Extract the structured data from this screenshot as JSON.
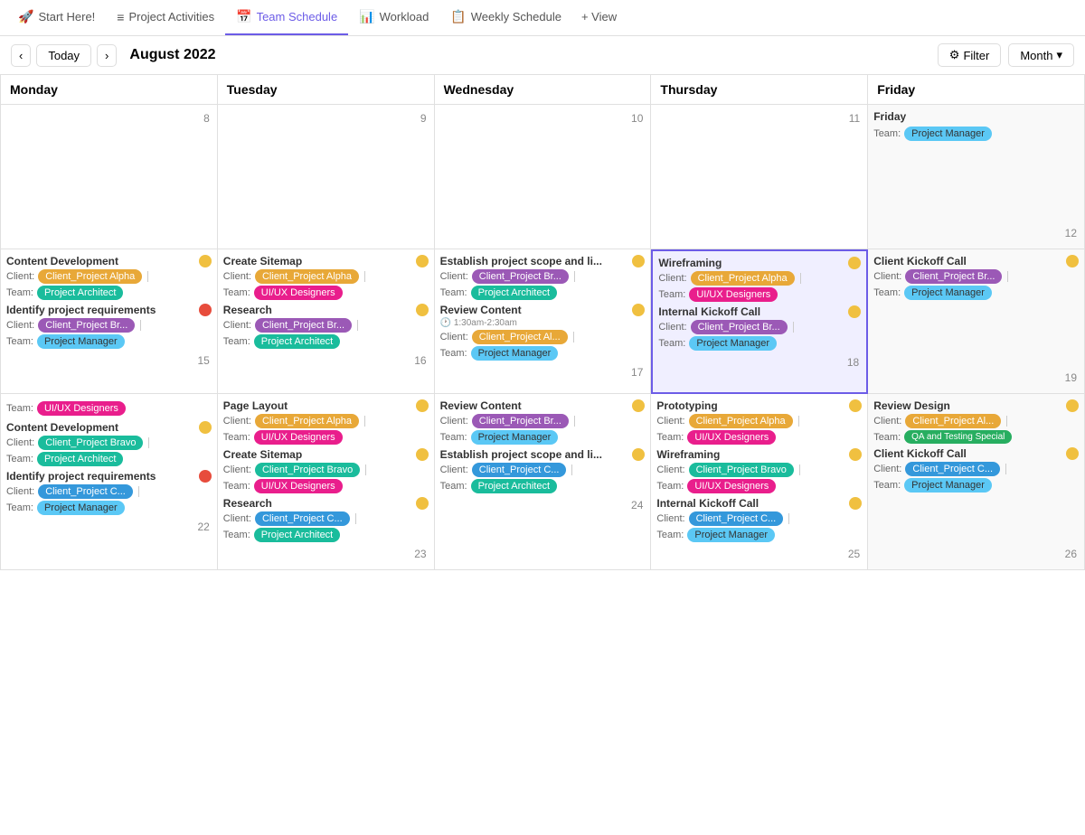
{
  "nav": {
    "tabs": [
      {
        "id": "start",
        "label": "Start Here!",
        "icon": "🚀",
        "active": false
      },
      {
        "id": "project-activities",
        "label": "Project Activities",
        "icon": "≡",
        "active": false
      },
      {
        "id": "team-schedule",
        "label": "Team Schedule",
        "icon": "📅",
        "active": true
      },
      {
        "id": "workload",
        "label": "Workload",
        "icon": "📊",
        "active": false
      },
      {
        "id": "weekly-schedule",
        "label": "Weekly Schedule",
        "icon": "📋",
        "active": false
      },
      {
        "id": "view",
        "label": "+ View",
        "icon": "",
        "active": false
      }
    ]
  },
  "toolbar": {
    "today_label": "Today",
    "month_display": "August 2022",
    "filter_label": "Filter",
    "month_label": "Month"
  },
  "calendar": {
    "headers": [
      "Monday",
      "Tuesday",
      "Wednesday",
      "Thursday",
      "Friday"
    ],
    "weeks": [
      {
        "days": [
          {
            "num": "8",
            "events": [],
            "highlighted": false
          },
          {
            "num": "9",
            "events": [],
            "highlighted": false
          },
          {
            "num": "10",
            "events": [],
            "highlighted": false
          },
          {
            "num": "11",
            "events": [],
            "highlighted": false
          },
          {
            "num": "12",
            "events": [],
            "highlighted": false,
            "partial": true
          }
        ]
      },
      {
        "days": [
          {
            "num": "15",
            "highlighted": false,
            "events": [
              {
                "title": "Content Development",
                "dot": "yellow",
                "client_label": "Client:",
                "client_tag": "Client_Project Alpha",
                "client_tag_color": "orange",
                "team_label": "Team:",
                "team_tag": "Project Architect",
                "team_tag_color": "teal"
              },
              {
                "title": "Identify project requirements",
                "dot": "red",
                "client_label": "Client:",
                "client_tag": "Client_Project Br...",
                "client_tag_color": "purple",
                "team_label": "Team:",
                "team_tag": "Project Manager",
                "team_tag_color": "light-blue"
              }
            ]
          },
          {
            "num": "16",
            "highlighted": false,
            "events": [
              {
                "title": "Create Sitemap",
                "dot": "yellow",
                "client_label": "Client:",
                "client_tag": "Client_Project Alpha",
                "client_tag_color": "orange",
                "team_label": "Team:",
                "team_tag": "UI/UX Designers",
                "team_tag_color": "pink"
              },
              {
                "title": "Research",
                "dot": "yellow",
                "client_label": "Client:",
                "client_tag": "Client_Project Br...",
                "client_tag_color": "purple",
                "team_label": "Team:",
                "team_tag": "Project Architect",
                "team_tag_color": "teal"
              }
            ]
          },
          {
            "num": "17",
            "highlighted": false,
            "events": [
              {
                "title": "Establish project scope and li...",
                "dot": "yellow",
                "client_label": "Client:",
                "client_tag": "Client_Project Br...",
                "client_tag_color": "purple",
                "team_label": "Team:",
                "team_tag": "Project Architect",
                "team_tag_color": "teal"
              },
              {
                "title": "Review Content",
                "dot": "yellow",
                "time": "🕐 1:30am-2:30am",
                "client_label": "Client:",
                "client_tag": "Client_Project Al...",
                "client_tag_color": "orange",
                "team_label": "Team:",
                "team_tag": "Project Manager",
                "team_tag_color": "light-blue"
              }
            ]
          },
          {
            "num": "18",
            "highlighted": true,
            "events": [
              {
                "title": "Wireframing",
                "dot": "yellow",
                "client_label": "Client:",
                "client_tag": "Client_Project Alpha",
                "client_tag_color": "orange",
                "team_label": "Team:",
                "team_tag": "UI/UX Designers",
                "team_tag_color": "pink"
              },
              {
                "title": "Internal Kickoff Call",
                "dot": "yellow",
                "client_label": "Client:",
                "client_tag": "Client_Project Br...",
                "client_tag_color": "purple",
                "team_label": "Team:",
                "team_tag": "Project Manager",
                "team_tag_color": "light-blue"
              }
            ]
          },
          {
            "num": "19",
            "highlighted": false,
            "partial": true,
            "pre_events": [
              {
                "team_label": "Team:",
                "team_tag": "Project Manager",
                "team_tag_color": "light-blue"
              }
            ],
            "events": [
              {
                "title": "Client Kickoff Call",
                "dot": "yellow",
                "client_label": "Client:",
                "client_tag": "Client_Project Br...",
                "client_tag_color": "purple",
                "team_label": "Team:",
                "team_tag": "Project Manager",
                "team_tag_color": "light-blue"
              }
            ]
          }
        ]
      },
      {
        "days": [
          {
            "num": "22",
            "highlighted": false,
            "pre_events": [
              {
                "team_label": "Team:",
                "team_tag": "UI/UX Designers",
                "team_tag_color": "pink"
              }
            ],
            "events": [
              {
                "title": "Content Development",
                "dot": "yellow",
                "client_label": "Client:",
                "client_tag": "Client_Project Bravo",
                "client_tag_color": "teal",
                "team_label": "Team:",
                "team_tag": "Project Architect",
                "team_tag_color": "teal"
              },
              {
                "title": "Identify project requirements",
                "dot": "red",
                "client_label": "Client:",
                "client_tag": "Client_Project C...",
                "client_tag_color": "blue",
                "team_label": "Team:",
                "team_tag": "Project Manager",
                "team_tag_color": "light-blue"
              }
            ]
          },
          {
            "num": "23",
            "highlighted": false,
            "pre_events": [
              {
                "title": "Page Layout",
                "dot": "yellow",
                "client_label": "Client:",
                "client_tag": "Client_Project Alpha",
                "client_tag_color": "orange",
                "team_label": "Team:",
                "team_tag": "UI/UX Designers",
                "team_tag_color": "pink"
              }
            ],
            "events": [
              {
                "title": "Create Sitemap",
                "dot": "yellow",
                "client_label": "Client:",
                "client_tag": "Client_Project Bravo",
                "client_tag_color": "teal",
                "team_label": "Team:",
                "team_tag": "UI/UX Designers",
                "team_tag_color": "pink"
              },
              {
                "title": "Research",
                "dot": "yellow",
                "client_label": "Client:",
                "client_tag": "Client_Project C...",
                "client_tag_color": "blue",
                "team_label": "Team:",
                "team_tag": "Project Architect",
                "team_tag_color": "teal"
              }
            ]
          },
          {
            "num": "24",
            "highlighted": false,
            "events": [
              {
                "title": "Review Content",
                "dot": "yellow",
                "client_label": "Client:",
                "client_tag": "Client_Project Br...",
                "client_tag_color": "purple",
                "team_label": "Team:",
                "team_tag": "Project Manager",
                "team_tag_color": "light-blue"
              },
              {
                "title": "Establish project scope and li...",
                "dot": "yellow",
                "client_label": "Client:",
                "client_tag": "Client_Project C...",
                "client_tag_color": "blue",
                "team_label": "Team:",
                "team_tag": "Project Architect",
                "team_tag_color": "teal"
              }
            ]
          },
          {
            "num": "25",
            "highlighted": false,
            "events": [
              {
                "title": "Prototyping",
                "dot": "yellow",
                "client_label": "Client:",
                "client_tag": "Client_Project Alpha",
                "client_tag_color": "orange",
                "team_label": "Team:",
                "team_tag": "UI/UX Designers",
                "team_tag_color": "pink"
              },
              {
                "title": "Wireframing",
                "dot": "yellow",
                "client_label": "Client:",
                "client_tag": "Client_Project Bravo",
                "client_tag_color": "teal",
                "team_label": "Team:",
                "team_tag": "UI/UX Designers",
                "team_tag_color": "pink"
              },
              {
                "title": "Internal Kickoff Call",
                "dot": "yellow",
                "client_label": "Client:",
                "client_tag": "Client_Project C...",
                "client_tag_color": "blue",
                "team_label": "Team:",
                "team_tag": "Project Manager",
                "team_tag_color": "light-blue"
              }
            ]
          },
          {
            "num": "26",
            "highlighted": false,
            "partial": true,
            "pre_events": [
              {
                "title": "Review Design",
                "dot": "yellow",
                "client_label": "Client:",
                "client_tag": "Client_Project Al...",
                "client_tag_color": "orange",
                "team_label": "Team:",
                "team_tag": "QA and Testing Special",
                "team_tag_color": "green"
              }
            ],
            "events": [
              {
                "title": "Client Kickoff Call",
                "dot": "yellow",
                "client_label": "Client:",
                "client_tag": "Client_Project C...",
                "client_tag_color": "blue",
                "team_label": "Team:",
                "team_tag": "Project Manager",
                "team_tag_color": "light-blue"
              }
            ]
          }
        ]
      }
    ]
  }
}
